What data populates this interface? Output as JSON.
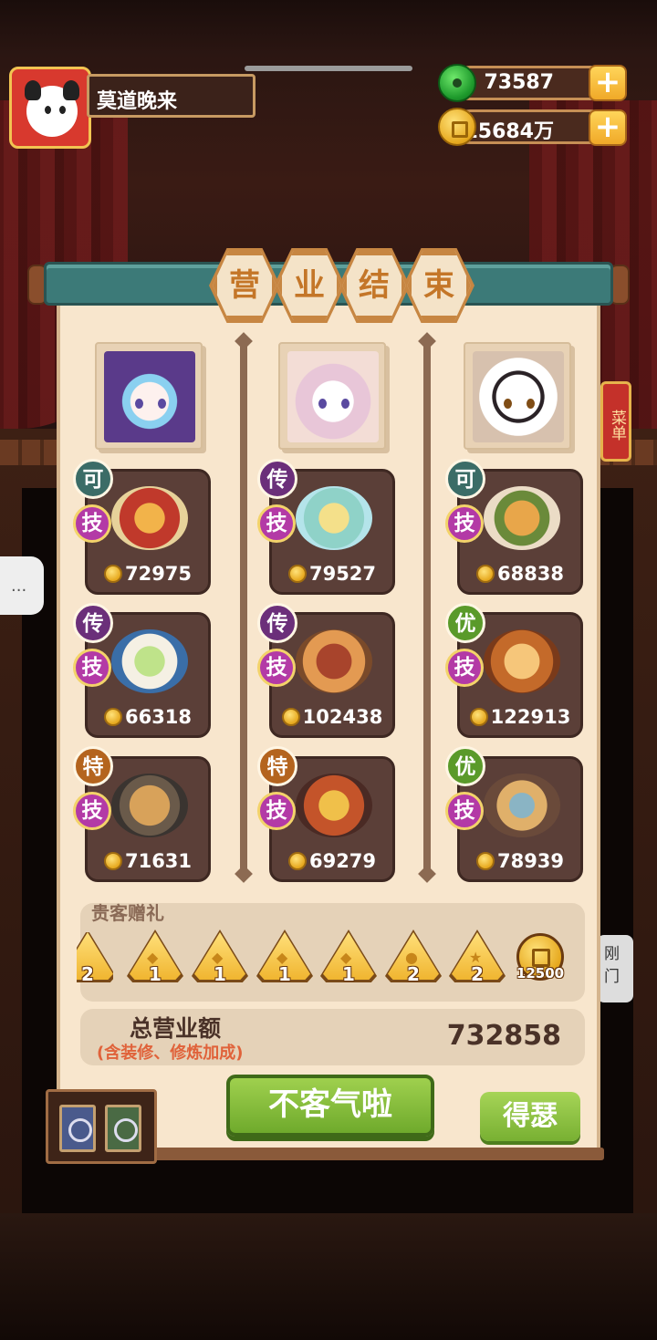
{
  "hud": {
    "player_name": "莫道晚来",
    "jade_amount": "73587",
    "coin_amount": "15684万",
    "plus_label": "+"
  },
  "panel": {
    "title_chars": [
      "营",
      "业",
      "结",
      "束"
    ],
    "chefs": [
      {
        "dishes": [
          {
            "rank": "可",
            "skill": "技",
            "price": "72975"
          },
          {
            "rank": "传",
            "skill": "技",
            "price": "66318"
          },
          {
            "rank": "特",
            "skill": "技",
            "price": "71631"
          }
        ]
      },
      {
        "dishes": [
          {
            "rank": "传",
            "skill": "技",
            "price": "79527"
          },
          {
            "rank": "传",
            "skill": "技",
            "price": "102438"
          },
          {
            "rank": "特",
            "skill": "技",
            "price": "69279"
          }
        ]
      },
      {
        "dishes": [
          {
            "rank": "可",
            "skill": "技",
            "price": "68838"
          },
          {
            "rank": "优",
            "skill": "技",
            "price": "122913"
          },
          {
            "rank": "优",
            "skill": "技",
            "price": "78939"
          }
        ]
      }
    ],
    "gifts": {
      "title": "贵客赠礼",
      "counts": [
        "2",
        "1",
        "1",
        "1",
        "1",
        "2",
        "2"
      ],
      "coin_count": "12500"
    },
    "total": {
      "label": "总营业额",
      "sub": "(含装修、修炼加成)",
      "value": "732858"
    },
    "buttons": {
      "main": "不客气啦",
      "secondary": "得瑟"
    }
  },
  "background": {
    "side_tag": "菜单",
    "side_bubble": "...",
    "right_bubble": "刚门"
  },
  "colors": {
    "rank_可": "#3b6c67",
    "rank_传": "#6b2f7a",
    "rank_优": "#5a9a2a",
    "rank_特": "#b4641e",
    "skill_badge": "#b33aa6",
    "button_green": "#86bf3c",
    "panel_bg": "#f8e6cd"
  }
}
